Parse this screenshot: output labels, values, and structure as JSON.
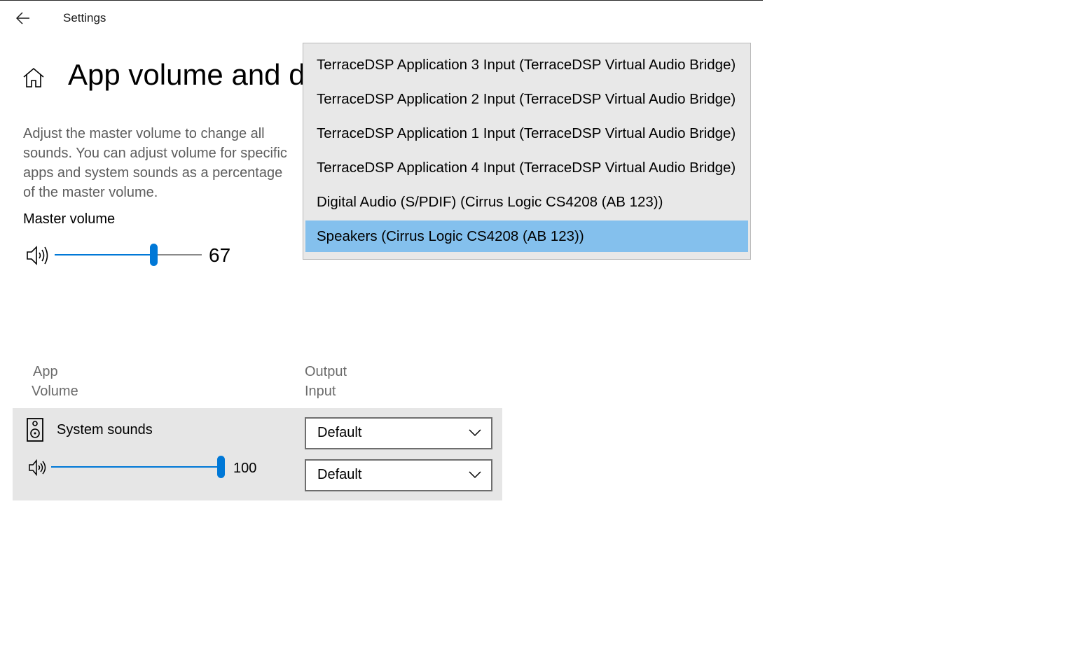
{
  "window": {
    "app_title": "Settings",
    "back_icon": "arrow-left-icon",
    "home_icon": "home-icon"
  },
  "page": {
    "title": "App volume and d",
    "description": "Adjust the master volume to change all sounds. You can adjust volume for specific apps and system sounds as a percentage of the master volume."
  },
  "master": {
    "label": "Master volume",
    "value": "67",
    "level": 0.67,
    "icon": "speaker-icon"
  },
  "columns": {
    "app": "App",
    "volume": "Volume",
    "output": "Output",
    "input": "Input"
  },
  "app_row": {
    "name": "System sounds",
    "icon": "speaker-device-icon",
    "value": "100",
    "level": 1.0,
    "output_selected": "Default",
    "input_selected": "Default"
  },
  "dropdown": {
    "options": [
      "TerraceDSP Application 3 Input (TerraceDSP Virtual Audio Bridge)",
      "TerraceDSP Application 2 Input (TerraceDSP Virtual Audio Bridge)",
      "TerraceDSP Application 1 Input (TerraceDSP Virtual Audio Bridge)",
      "TerraceDSP Application 4 Input (TerraceDSP Virtual Audio Bridge)",
      "Digital Audio (S/PDIF) (Cirrus Logic CS4208 (AB 123))",
      "Speakers (Cirrus Logic CS4208 (AB 123))"
    ],
    "selected_index": 5
  },
  "colors": {
    "accent": "#0078d7",
    "selection": "#84c0ed",
    "row_background": "#e6e6e6"
  }
}
